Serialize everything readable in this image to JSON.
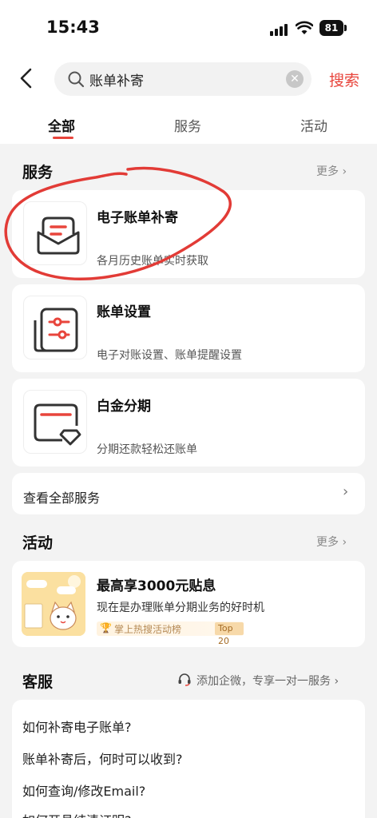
{
  "status_bar": {
    "time": "15:43",
    "battery": "81"
  },
  "search": {
    "value": "账单补寄",
    "button_label": "搜索"
  },
  "tabs": [
    {
      "label": "全部"
    },
    {
      "label": "服务"
    },
    {
      "label": "活动"
    }
  ],
  "services": {
    "title": "服务",
    "more": "更多",
    "items": [
      {
        "title": "电子账单补寄",
        "desc": "各月历史账单实时获取"
      },
      {
        "title": "账单设置",
        "desc": "电子对账设置、账单提醒设置"
      },
      {
        "title": "白金分期",
        "desc": "分期还款轻松还账单"
      }
    ],
    "view_all": "查看全部服务"
  },
  "activities": {
    "title": "活动",
    "more": "更多",
    "promo": {
      "title": "最高享3000元贴息",
      "desc": "现在是办理账单分期业务的好时机",
      "badge": "掌上热搜活动榜",
      "rank": "Top 20"
    }
  },
  "customer_service": {
    "title": "客服",
    "extra": "添加企微，专享一对一服务",
    "questions": [
      "如何补寄电子账单?",
      "账单补寄后，何时可以收到?",
      "如何查询/修改Email?",
      "如何开具结清证明?"
    ]
  },
  "colors": {
    "accent": "#e8453c",
    "annotation": "#e23b36"
  }
}
